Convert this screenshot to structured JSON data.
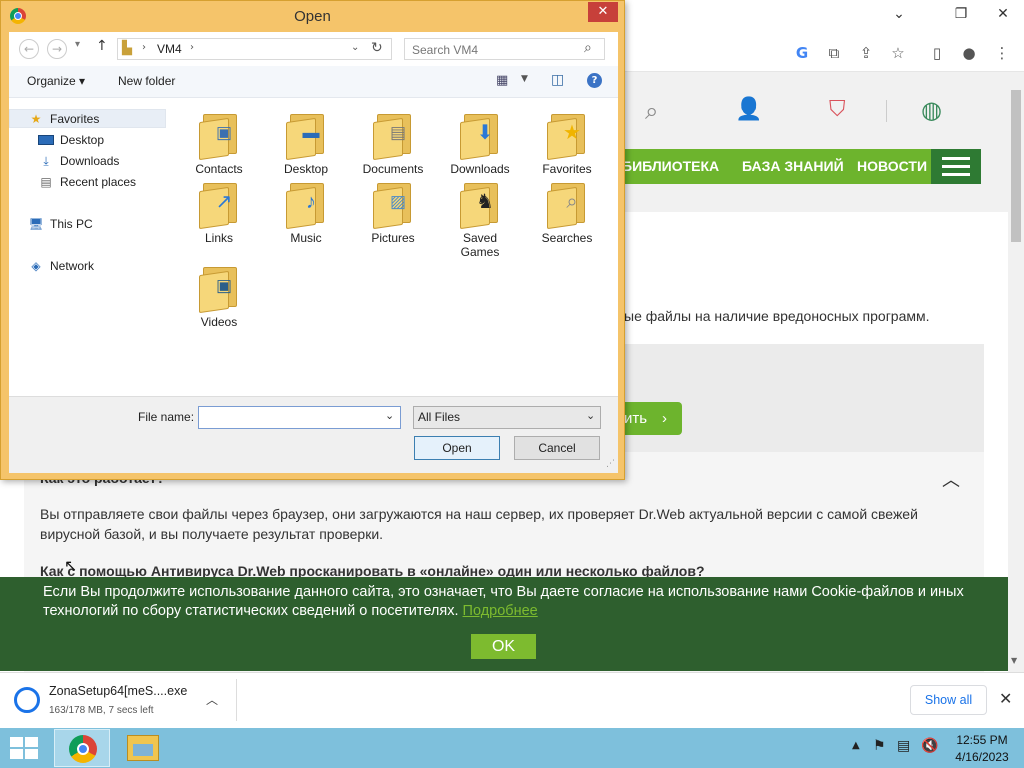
{
  "dialog": {
    "title": "Open",
    "close_label": "✕",
    "path_segment": "VM4",
    "search_placeholder": "Search VM4",
    "organize_label": "Organize ▾",
    "new_folder_label": "New folder",
    "tree": [
      {
        "label": "Favorites",
        "icon": "star-icon"
      },
      {
        "label": "Desktop",
        "icon": "desktop-icon"
      },
      {
        "label": "Downloads",
        "icon": "downloads-icon"
      },
      {
        "label": "Recent places",
        "icon": "recent-places-icon"
      },
      {
        "label": "This PC",
        "icon": "computer-icon"
      },
      {
        "label": "Network",
        "icon": "network-icon"
      }
    ],
    "folders": [
      {
        "label": "Contacts",
        "icon": "contacts-icon"
      },
      {
        "label": "Desktop",
        "icon": "desktop-icon"
      },
      {
        "label": "Documents",
        "icon": "documents-icon"
      },
      {
        "label": "Downloads",
        "icon": "downloads-icon"
      },
      {
        "label": "Favorites",
        "icon": "star-icon"
      },
      {
        "label": "Links",
        "icon": "links-icon"
      },
      {
        "label": "Music",
        "icon": "music-icon"
      },
      {
        "label": "Pictures",
        "icon": "pictures-icon"
      },
      {
        "label": "Saved Games",
        "icon": "chess-icon"
      },
      {
        "label": "Searches",
        "icon": "search-icon"
      },
      {
        "label": "Videos",
        "icon": "videos-icon"
      }
    ],
    "filename_label": "File name:",
    "filename_value": "",
    "filetype_value": "All Files",
    "open_label": "Open",
    "cancel_label": "Cancel"
  },
  "site": {
    "nav": [
      "БИБЛИОТЕКА",
      "БАЗА ЗНАНИЙ",
      "НОВОСТИ"
    ],
    "intro_fragment": "ые файлы на наличие вредоносных программ.",
    "button_fragment": "ить",
    "faq_q1_fragment": "Как это работает?",
    "faq_a1_line1": "Вы отправляете свои файлы через браузер, они загружаются на наш сервер, их проверяет Dr.Web актуальной версии с самой свежей",
    "faq_a1_line2": "вирусной базой, и вы получаете результат проверки.",
    "faq_q2": "Как с помощью Антивируса Dr.Web просканировать в «онлайне» один или несколько файлов?",
    "cookie_line1": "Если Вы продолжите использование данного сайта, это означает, что Вы даете согласие на использование нами Cookie-файлов и иных",
    "cookie_line2": "технологий по сбору статистических сведений о посетителях.",
    "cookie_link": "Подробнее",
    "cookie_ok": "OK"
  },
  "download": {
    "filename": "ZonaSetup64[meS....exe",
    "status": "163/178 MB, 7 secs left",
    "show_all": "Show all",
    "progress": 0.916
  },
  "taskbar": {
    "time": "12:55 PM",
    "date": "4/16/2023"
  },
  "colors": {
    "accent_green": "#6db42d",
    "dark_green": "#2e5f2e",
    "dialog_frame": "#f5c46a",
    "close_red": "#c7403a"
  }
}
